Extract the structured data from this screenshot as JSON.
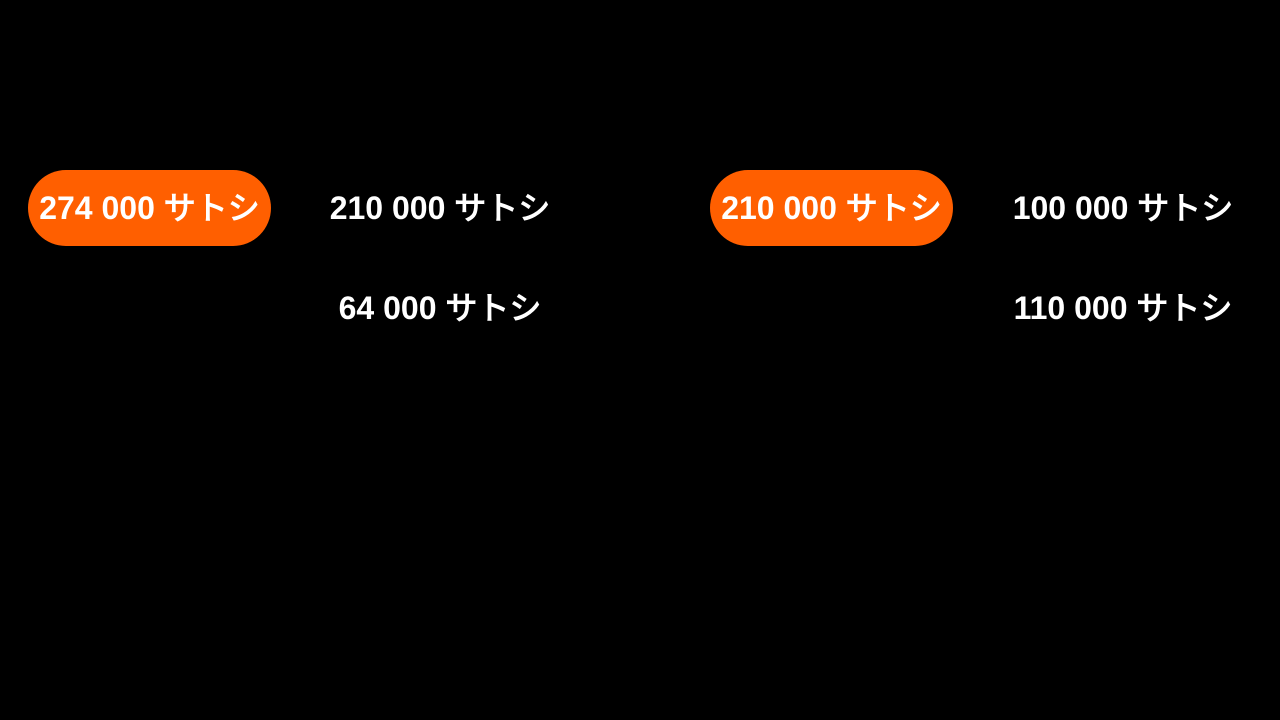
{
  "left_group": {
    "input": "274 000 サトシ",
    "outputs": [
      "210 000 サトシ",
      "64 000 サトシ"
    ]
  },
  "right_group": {
    "input": "210 000 サトシ",
    "outputs": [
      "100 000 サトシ",
      "110 000 サトシ"
    ]
  },
  "colors": {
    "background": "#000000",
    "pill": "#ff5f00",
    "text": "#ffffff"
  }
}
